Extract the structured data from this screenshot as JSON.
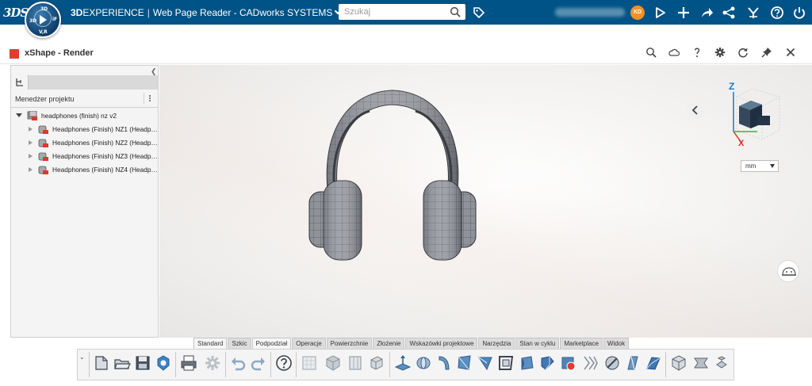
{
  "topbar": {
    "brand_bold": "3D",
    "brand_rest": "EXPERIENCE",
    "separator": "|",
    "app_name": "Web Page Reader - CADworks SYSTEMS",
    "search_placeholder": "Szukaj",
    "avatar_initials": "KD",
    "compass": {
      "q_top": "3D",
      "q_left": "3D",
      "q_right": "iF",
      "q_bottom": "V,R"
    },
    "colors": {
      "bar": "#005386",
      "avatar": "#f29127"
    }
  },
  "app": {
    "title": "xShape - Render",
    "header_icons": [
      "search-icon",
      "cloud-icon",
      "help-icon",
      "settings-gear-icon",
      "refresh-icon",
      "pin-icon",
      "close-icon"
    ]
  },
  "panel": {
    "manager_title": "Menedżer projektu",
    "tree": [
      {
        "label": "headphones (finish) nz v2",
        "expanded": true,
        "level": 0
      },
      {
        "label": "Headphones (Finish) NZ1  (Headp…",
        "level": 1
      },
      {
        "label": "Headphones (Finish) NZ2  (Headp…",
        "level": 1
      },
      {
        "label": "Headphones (Finish) NZ3  (Headp…",
        "level": 1
      },
      {
        "label": "Headphones (Finish) NZ4  (Headp…",
        "level": 1
      }
    ]
  },
  "viewport": {
    "axis_z": "Z",
    "axis_x": "X",
    "unit": "mm"
  },
  "command_tabs": [
    {
      "label": "Standard",
      "active": true
    },
    {
      "label": "Szkic"
    },
    {
      "label": "Podpodział",
      "active": true
    },
    {
      "label": "Operacje"
    },
    {
      "label": "Powierzchnie"
    },
    {
      "label": "Złożenie"
    },
    {
      "label": "Wskazówki projektowe"
    },
    {
      "label": "Narzędzia"
    },
    {
      "label": "Stan w cyklu"
    },
    {
      "label": "Marketplace"
    },
    {
      "label": "Widok"
    }
  ],
  "toolbar_icons": [
    "new-icon",
    "open-icon",
    "save-icon",
    "save-all-icon",
    "print-icon",
    "options-gear-icon",
    "undo-icon",
    "redo-icon",
    "help-circle-icon",
    "sketch-grid-icon",
    "box-icon",
    "grid-plane-icon",
    "view-cube-icon",
    "extrude-icon",
    "revolve-icon",
    "sweep-icon",
    "loft-icon",
    "fillet-icon",
    "shell-icon",
    "draft-icon",
    "chamfer-icon",
    "mirror-icon",
    "delete-face-icon",
    "split-icon",
    "intersect-icon",
    "thicken-icon",
    "wrap-icon",
    "assembly-icon",
    "mate-icon",
    "explode-icon"
  ]
}
